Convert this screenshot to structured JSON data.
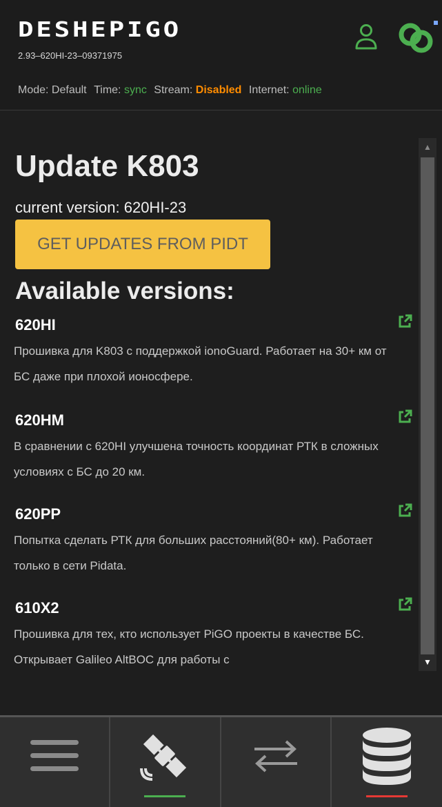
{
  "header": {
    "logo": "DESHEPIGO",
    "serial": "2.93–620HI-23–09371975",
    "status": {
      "mode_label": "Mode:",
      "mode_value": "Default",
      "time_label": "Time:",
      "time_value": "sync",
      "stream_label": "Stream:",
      "stream_value": "Disabled",
      "internet_label": "Internet:",
      "internet_value": "online"
    }
  },
  "main": {
    "title": "Update K803",
    "current_version": "current version: 620HI-23",
    "get_updates_label": "GET UPDATES FROM PIDT",
    "available_heading": "Available versions:",
    "versions": [
      {
        "name": "620HI",
        "description": "Прошивка для K803 с поддержкой ionoGuard. Работает на 30+ км от БС даже при плохой ионосфере."
      },
      {
        "name": "620HM",
        "description": "В сравнении с 620HI улучшена точность координат РТК в сложных условиях с БС до 20 км."
      },
      {
        "name": "620PP",
        "description": "Попытка сделать РТК для больших расстояний(80+ км). Работает только в сети Pidata."
      },
      {
        "name": "610X2",
        "description": "Прошивка для тех, кто использует PiGO проекты в качестве БС. Открывает Galileo AltBOC для работы с"
      }
    ]
  },
  "icons": {
    "user": "user-icon",
    "connection": "link-icon",
    "external": "external-link-icon",
    "nav": [
      "menu-icon",
      "satellite-icon",
      "transfer-arrows-icon",
      "database-icon"
    ]
  },
  "bottom_nav": {
    "active_indicators": {
      "satellite": "#4caf50",
      "database": "#e53935"
    }
  },
  "colors": {
    "accent_green": "#4caf50",
    "warning_orange": "#ff8c00",
    "button_yellow": "#f5c242",
    "indicator_red": "#e53935"
  }
}
